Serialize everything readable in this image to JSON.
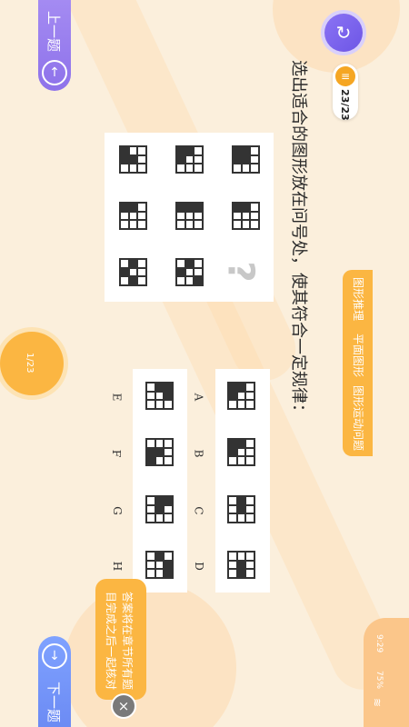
{
  "nav": {
    "prev_label": "上一题",
    "next_label": "下一题",
    "prev_icon": "arrow-up-icon",
    "next_icon": "arrow-down-icon"
  },
  "question": {
    "text": "选出适合的图形放在问号处，使其符合一定规律：",
    "counter": "23/23",
    "missing_mark": "?"
  },
  "progress": {
    "text": "1/23"
  },
  "tags": [
    "图形推理",
    "平面图形",
    "图形运动问题"
  ],
  "tip": {
    "line1": "答案将在章节所有题",
    "line2": "目完成之后一起核对"
  },
  "status": {
    "time": "9:29",
    "battery": "75%"
  },
  "colors": {
    "accent": "#fbb642",
    "purple": "#8b73f4",
    "blue": "#6c8bf4"
  },
  "puzzle": [
    [
      {
        "cells": [
          1,
          1,
          0,
          1,
          1,
          0,
          0,
          0,
          0
        ]
      },
      {
        "cells": [
          1,
          1,
          0,
          1,
          0,
          0,
          0,
          0,
          0
        ]
      },
      {
        "cells": [
          1,
          0,
          0,
          1,
          1,
          0,
          0,
          0,
          0
        ]
      }
    ],
    [
      {
        "cells": [
          1,
          1,
          0,
          0,
          0,
          0,
          0,
          0,
          0
        ]
      },
      {
        "cells": [
          1,
          1,
          1,
          0,
          0,
          0,
          0,
          0,
          0
        ]
      },
      {
        "cells": [
          1,
          1,
          0,
          0,
          0,
          0,
          0,
          0,
          0
        ]
      }
    ],
    [
      {
        "missing": true
      },
      {
        "cells": [
          0,
          1,
          0,
          1,
          0,
          0,
          0,
          0,
          1
        ]
      },
      {
        "cells": [
          0,
          1,
          0,
          1,
          0,
          0,
          0,
          1,
          0
        ]
      }
    ]
  ],
  "options_top": [
    {
      "label": "A",
      "cells": [
        1,
        1,
        0,
        1,
        0,
        0,
        0,
        0,
        0
      ]
    },
    {
      "label": "B",
      "cells": [
        1,
        1,
        0,
        1,
        0,
        0,
        0,
        0,
        0
      ]
    },
    {
      "label": "C",
      "cells": [
        0,
        1,
        0,
        0,
        1,
        0,
        0,
        0,
        0
      ]
    },
    {
      "label": "D",
      "cells": [
        0,
        0,
        0,
        0,
        1,
        0,
        0,
        1,
        0
      ]
    }
  ],
  "options_bottom": [
    {
      "label": "E",
      "cells": [
        0,
        1,
        1,
        0,
        0,
        1,
        0,
        0,
        0
      ]
    },
    {
      "label": "F",
      "cells": [
        0,
        0,
        0,
        1,
        1,
        0,
        1,
        0,
        0
      ]
    },
    {
      "label": "G",
      "cells": [
        0,
        1,
        1,
        0,
        1,
        0,
        0,
        0,
        0
      ]
    },
    {
      "label": "H",
      "cells": [
        0,
        1,
        0,
        0,
        0,
        1,
        0,
        0,
        1
      ]
    }
  ]
}
